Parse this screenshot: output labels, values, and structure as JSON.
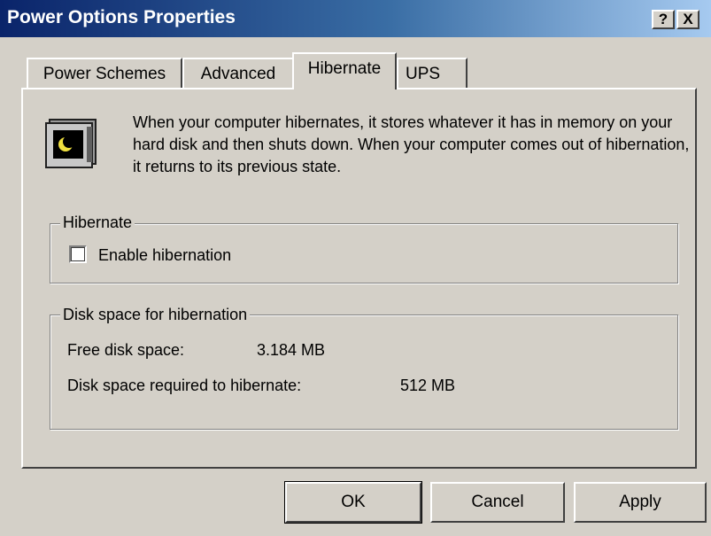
{
  "window": {
    "title": "Power Options Properties",
    "help_button": "?",
    "close_button": "X"
  },
  "tabs": [
    {
      "label": "Power Schemes",
      "active": false
    },
    {
      "label": "Advanced",
      "active": false
    },
    {
      "label": "Hibernate",
      "active": true
    },
    {
      "label": "UPS",
      "active": false
    }
  ],
  "hibernate": {
    "icon": "monitor-moon-icon",
    "description": "When your computer hibernates, it stores whatever it has in memory on your hard disk and then shuts down. When your computer comes out of hibernation, it returns to its previous state.",
    "group_label": "Hibernate",
    "enable_label": "Enable hibernation",
    "enable_checked": false
  },
  "disk_space": {
    "group_label": "Disk space for hibernation",
    "free_label": "Free disk space:",
    "free_value": "3.184 MB",
    "required_label": "Disk space required to hibernate:",
    "required_value": "512 MB"
  },
  "buttons": {
    "ok": "OK",
    "cancel": "Cancel",
    "apply": "Apply"
  }
}
